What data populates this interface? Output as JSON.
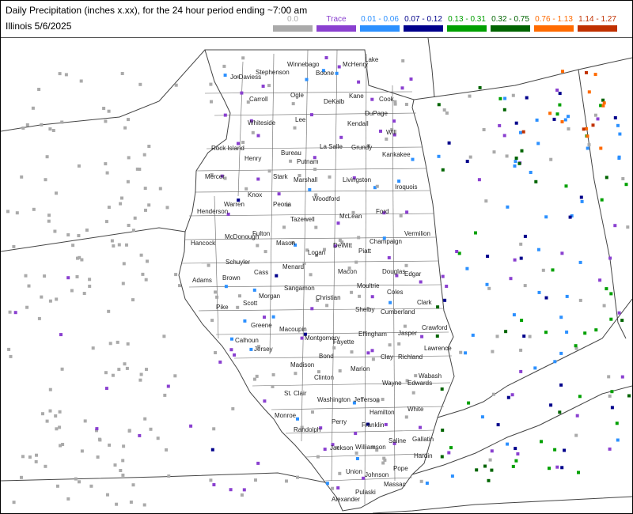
{
  "header": {
    "title": "Daily Precipitation (inches  x.xx),  for the 24 hour period ending ~7:00 am",
    "subtitle": "Illinois 5/6/2025"
  },
  "legend": [
    {
      "label": "0.0",
      "color": "#aaaaaa"
    },
    {
      "label": "Trace",
      "color": "#8a40d0"
    },
    {
      "label": "0.01 - 0.06",
      "color": "#2b90ff"
    },
    {
      "label": "0.07 - 0.12",
      "color": "#00008b"
    },
    {
      "label": "0.13 - 0.31",
      "color": "#00a000"
    },
    {
      "label": "0.32 - 0.75",
      "color": "#006400"
    },
    {
      "label": "0.76 - 1.13",
      "color": "#ff6a00"
    },
    {
      "label": "1.14 - 1.27",
      "color": "#c03000"
    }
  ],
  "counties": [
    "Jo Daviess",
    "Stephenson",
    "Winnebago",
    "Boone",
    "McHenry",
    "Lake",
    "Carroll",
    "Ogle",
    "DeKalb",
    "Kane",
    "Cook",
    "DuPage",
    "Whiteside",
    "Lee",
    "Kendall",
    "Will",
    "Rock Island",
    "Henry",
    "Bureau",
    "Putnam",
    "La Salle",
    "Grundy",
    "Kankakee",
    "Mercer",
    "Stark",
    "Marshall",
    "Livingston",
    "Iroquois",
    "Knox",
    "Peoria",
    "Woodford",
    "Warren",
    "Henderson",
    "Tazewell",
    "McLean",
    "Ford",
    "Hancock",
    "McDonough",
    "Fulton",
    "Mason",
    "DeWitt",
    "Champaign",
    "Vermilion",
    "Schuyler",
    "Logan",
    "Piatt",
    "Adams",
    "Brown",
    "Cass",
    "Menard",
    "Macon",
    "Douglas",
    "Edgar",
    "Morgan",
    "Sangamon",
    "Moultrie",
    "Coles",
    "Scott",
    "Christian",
    "Pike",
    "Clark",
    "Shelby",
    "Cumberland",
    "Greene",
    "Macoupin",
    "Calhoun",
    "Montgomery",
    "Effingham",
    "Jasper",
    "Crawford",
    "Jersey",
    "Fayette",
    "Lawrence",
    "Bond",
    "Clay",
    "Richland",
    "Madison",
    "Marion",
    "Wabash",
    "Clinton",
    "St. Clair",
    "Wayne",
    "Edwards",
    "Washington",
    "Jefferson",
    "Monroe",
    "White",
    "Hamilton",
    "Perry",
    "Franklin",
    "Randolph",
    "Gallatin",
    "Saline",
    "Jackson",
    "Williamson",
    "Hardin",
    "Pope",
    "Union",
    "Johnson",
    "Pulaski",
    "Massac",
    "Alexander"
  ]
}
